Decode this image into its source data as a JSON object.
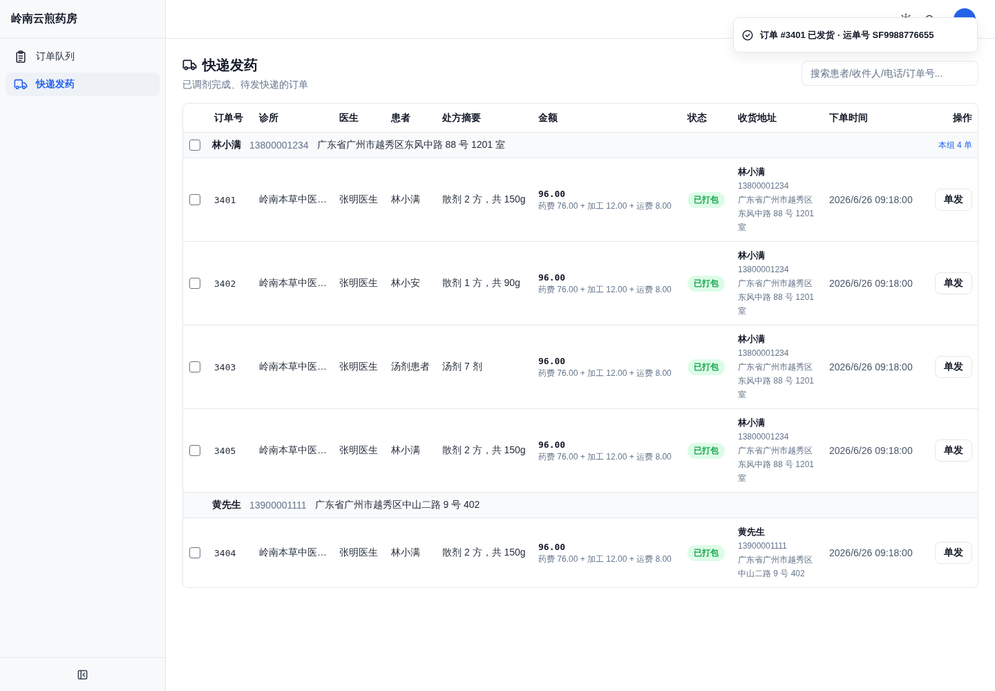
{
  "app": {
    "title": "岭南云煎药房"
  },
  "sidebar": {
    "items": [
      {
        "label": "订单队列",
        "selected": false
      },
      {
        "label": "快递发药",
        "selected": true
      }
    ]
  },
  "toast": {
    "message": "订单 #3401 已发货 · 运单号 SF9988776655"
  },
  "page": {
    "title": "快递发药",
    "subtitle": "已调剂完成、待发快递的订单"
  },
  "search": {
    "placeholder": "搜索患者/收件人/电话/订单号..."
  },
  "table": {
    "columns": [
      "订单号",
      "诊所",
      "医生",
      "患者",
      "处方摘要",
      "金额",
      "状态",
      "收货地址",
      "下单时间",
      "操作"
    ],
    "groups": [
      {
        "checked": false,
        "recipient": "林小满",
        "phone": "13800001234",
        "address": "广东省广州市越秀区东风中路 88 号 1201 室",
        "count": "本组 4 单",
        "rows": [
          {
            "checked": false,
            "order": "3401",
            "clinic": "岭南本草中医…",
            "doctor": "张明医生",
            "patient": "林小满",
            "rx": "散剂 2 方，共 150g",
            "amount": "96.00",
            "amount_detail": "药费 76.00 + 加工 12.00 + 运费 8.00",
            "status": "已打包",
            "recipient": "林小满",
            "phone": "13800001234",
            "address": "广东省广州市越秀区东风中路 88 号 1201 室",
            "time": "2026/6/26 09:18:00",
            "action": "单发"
          },
          {
            "checked": false,
            "order": "3402",
            "clinic": "岭南本草中医…",
            "doctor": "张明医生",
            "patient": "林小安",
            "rx": "散剂 1 方，共 90g",
            "amount": "96.00",
            "amount_detail": "药费 76.00 + 加工 12.00 + 运费 8.00",
            "status": "已打包",
            "recipient": "林小满",
            "phone": "13800001234",
            "address": "广东省广州市越秀区东风中路 88 号 1201 室",
            "time": "2026/6/26 09:18:00",
            "action": "单发"
          },
          {
            "checked": false,
            "order": "3403",
            "clinic": "岭南本草中医…",
            "doctor": "张明医生",
            "patient": "汤剂患者",
            "rx": "汤剂 7 剂",
            "amount": "96.00",
            "amount_detail": "药费 76.00 + 加工 12.00 + 运费 8.00",
            "status": "已打包",
            "recipient": "林小满",
            "phone": "13800001234",
            "address": "广东省广州市越秀区东风中路 88 号 1201 室",
            "time": "2026/6/26 09:18:00",
            "action": "单发"
          },
          {
            "checked": false,
            "order": "3405",
            "clinic": "岭南本草中医…",
            "doctor": "张明医生",
            "patient": "林小满",
            "rx": "散剂 2 方，共 150g",
            "amount": "96.00",
            "amount_detail": "药费 76.00 + 加工 12.00 + 运费 8.00",
            "status": "已打包",
            "recipient": "林小满",
            "phone": "13800001234",
            "address": "广东省广州市越秀区东风中路 88 号 1201 室",
            "time": "2026/6/26 09:18:00",
            "action": "单发"
          }
        ]
      },
      {
        "recipient": "黄先生",
        "phone": "13900001111",
        "address": "广东省广州市越秀区中山二路 9 号 402",
        "rows": [
          {
            "checked": false,
            "order": "3404",
            "clinic": "岭南本草中医…",
            "doctor": "张明医生",
            "patient": "林小满",
            "rx": "散剂 2 方，共 150g",
            "amount": "96.00",
            "amount_detail": "药费 76.00 + 加工 12.00 + 运费 8.00",
            "status": "已打包",
            "recipient": "黄先生",
            "phone": "13900001111",
            "address": "广东省广州市越秀区中山二路 9 号 402",
            "time": "2026/6/26 09:18:00",
            "action": "单发"
          }
        ]
      }
    ]
  }
}
